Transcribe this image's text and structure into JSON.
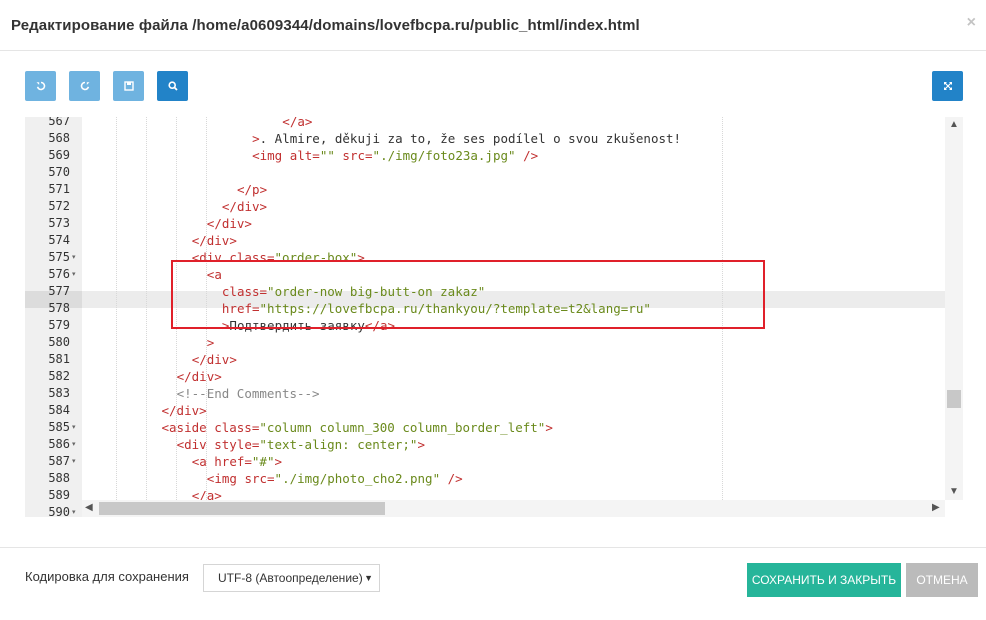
{
  "dialog": {
    "title": "Редактирование файла /home/a0609344/domains/lovefbcpa.ru/public_html/index.html",
    "close_label": "×"
  },
  "toolbar": {
    "undo_icon": "undo-icon",
    "redo_icon": "redo-icon",
    "save_icon": "save-icon",
    "search_icon": "search-icon",
    "fullscreen_icon": "fullscreen-icon"
  },
  "editor": {
    "lines": [
      {
        "num": "567",
        "fold": false,
        "indent": 26,
        "tokens": [
          {
            "c": "t-tag",
            "t": "</a>"
          }
        ],
        "partial": true
      },
      {
        "num": "568",
        "fold": false,
        "indent": 22,
        "tokens": [
          {
            "c": "t-tag",
            "t": ">"
          },
          {
            "c": "t-plain",
            "t": ". Almire, děkuji za to, že ses podílel o svou zkušenost!"
          }
        ]
      },
      {
        "num": "569",
        "fold": false,
        "indent": 22,
        "tokens": [
          {
            "c": "t-tag",
            "t": "<img "
          },
          {
            "c": "t-attr",
            "t": "alt="
          },
          {
            "c": "t-val",
            "t": "\"\""
          },
          {
            "c": "t-attr",
            "t": " src="
          },
          {
            "c": "t-val",
            "t": "\"./img/foto23a.jpg\""
          },
          {
            "c": "t-tag",
            "t": " />"
          }
        ]
      },
      {
        "num": "570",
        "fold": false,
        "indent": 0,
        "tokens": []
      },
      {
        "num": "571",
        "fold": false,
        "indent": 20,
        "tokens": [
          {
            "c": "t-tag",
            "t": "</p>"
          }
        ]
      },
      {
        "num": "572",
        "fold": false,
        "indent": 18,
        "tokens": [
          {
            "c": "t-tag",
            "t": "</div>"
          }
        ]
      },
      {
        "num": "573",
        "fold": false,
        "indent": 16,
        "tokens": [
          {
            "c": "t-tag",
            "t": "</div>"
          }
        ]
      },
      {
        "num": "574",
        "fold": false,
        "indent": 14,
        "tokens": [
          {
            "c": "t-tag",
            "t": "</div>"
          }
        ]
      },
      {
        "num": "575",
        "fold": true,
        "indent": 14,
        "tokens": [
          {
            "c": "t-tag",
            "t": "<div "
          },
          {
            "c": "t-attr",
            "t": "class="
          },
          {
            "c": "t-val",
            "t": "\"order-box\""
          },
          {
            "c": "t-tag",
            "t": ">"
          }
        ]
      },
      {
        "num": "576",
        "fold": true,
        "indent": 16,
        "tokens": [
          {
            "c": "t-tag",
            "t": "<a"
          }
        ]
      },
      {
        "num": "577",
        "fold": false,
        "indent": 18,
        "tokens": [
          {
            "c": "t-attr",
            "t": "class="
          },
          {
            "c": "t-val",
            "t": "\"order-now big-butt-on zakaz\""
          }
        ]
      },
      {
        "num": "578",
        "fold": false,
        "indent": 18,
        "tokens": [
          {
            "c": "t-attr",
            "t": "href="
          },
          {
            "c": "t-val",
            "t": "\"https://lovefbcpa.ru/thankyou/?template=t2&lang=ru\""
          }
        ]
      },
      {
        "num": "579",
        "fold": false,
        "indent": 18,
        "tokens": [
          {
            "c": "t-tag",
            "t": ">"
          },
          {
            "c": "t-plain",
            "t": "Подтвердить заявку"
          },
          {
            "c": "t-tag",
            "t": "</a>"
          }
        ]
      },
      {
        "num": "580",
        "fold": false,
        "indent": 16,
        "tokens": [
          {
            "c": "t-tag",
            "t": ">"
          }
        ]
      },
      {
        "num": "581",
        "fold": false,
        "indent": 14,
        "tokens": [
          {
            "c": "t-tag",
            "t": "</div>"
          }
        ]
      },
      {
        "num": "582",
        "fold": false,
        "indent": 12,
        "tokens": [
          {
            "c": "t-tag",
            "t": "</div>"
          }
        ]
      },
      {
        "num": "583",
        "fold": false,
        "indent": 12,
        "tokens": [
          {
            "c": "t-com",
            "t": "<!--End Comments-->"
          }
        ]
      },
      {
        "num": "584",
        "fold": false,
        "indent": 10,
        "tokens": [
          {
            "c": "t-tag",
            "t": "</div>"
          }
        ]
      },
      {
        "num": "585",
        "fold": true,
        "indent": 10,
        "tokens": [
          {
            "c": "t-tag",
            "t": "<aside "
          },
          {
            "c": "t-attr",
            "t": "class="
          },
          {
            "c": "t-val",
            "t": "\"column column_300 column_border_left\""
          },
          {
            "c": "t-tag",
            "t": ">"
          }
        ]
      },
      {
        "num": "586",
        "fold": true,
        "indent": 12,
        "tokens": [
          {
            "c": "t-tag",
            "t": "<div "
          },
          {
            "c": "t-attr",
            "t": "style="
          },
          {
            "c": "t-val",
            "t": "\"text-align: center;\""
          },
          {
            "c": "t-tag",
            "t": ">"
          }
        ]
      },
      {
        "num": "587",
        "fold": true,
        "indent": 14,
        "tokens": [
          {
            "c": "t-tag",
            "t": "<a "
          },
          {
            "c": "t-attr",
            "t": "href="
          },
          {
            "c": "t-val",
            "t": "\"#\""
          },
          {
            "c": "t-tag",
            "t": ">"
          }
        ]
      },
      {
        "num": "588",
        "fold": false,
        "indent": 16,
        "tokens": [
          {
            "c": "t-tag",
            "t": "<img "
          },
          {
            "c": "t-attr",
            "t": "src="
          },
          {
            "c": "t-val",
            "t": "\"./img/photo_cho2.png\""
          },
          {
            "c": "t-tag",
            "t": " />"
          }
        ]
      },
      {
        "num": "589",
        "fold": false,
        "indent": 14,
        "tokens": [
          {
            "c": "t-tag",
            "t": "</a>"
          }
        ]
      },
      {
        "num": "590",
        "fold": true,
        "indent": 14,
        "tokens": [],
        "partial": true
      }
    ],
    "active_line": "578"
  },
  "footer": {
    "encoding_label": "Кодировка для сохранения",
    "encoding_value": "UTF-8 (Автоопределение)",
    "save_close_label": "СОХРАНИТЬ И ЗАКРЫТЬ",
    "cancel_label": "ОТМЕНА"
  },
  "colors": {
    "save_button": "#26b59a",
    "toolbar_dark": "#2283c8",
    "toolbar_light": "#6fb3e0",
    "highlight_box": "#e0202a"
  }
}
